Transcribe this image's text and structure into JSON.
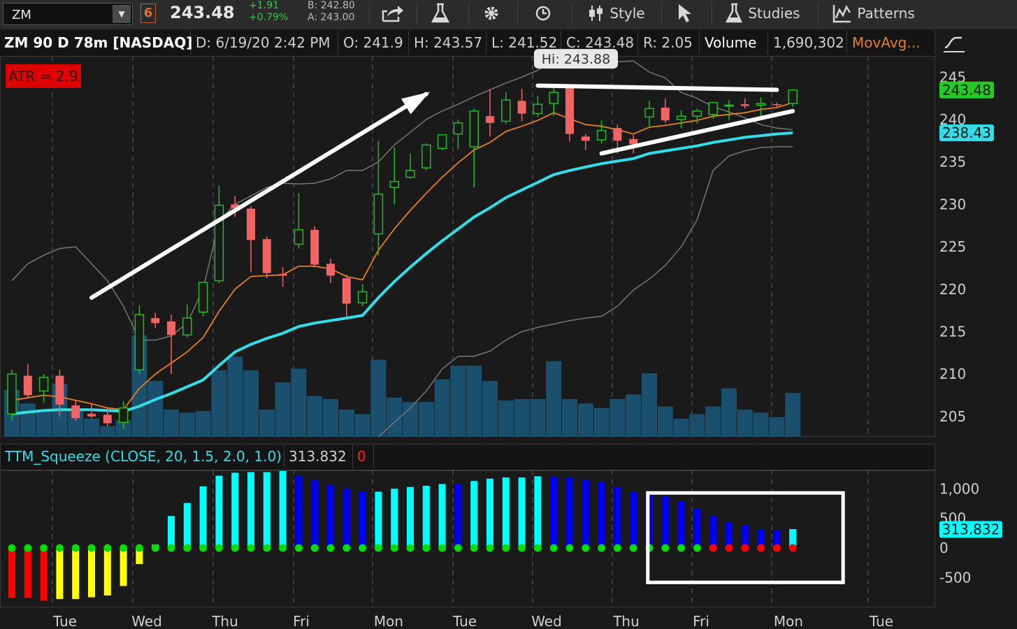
{
  "toolbar": {
    "symbol": "ZM",
    "badge": "6",
    "last": "243.48",
    "change": "+1.91",
    "change_pct": "+0.79%",
    "bid": "B: 242.80",
    "ask": "A: 243.00",
    "style_label": "Style",
    "studies_label": "Studies",
    "patterns_label": "Patterns"
  },
  "infobar": {
    "title": "ZM 90 D 78m [NASDAQ]",
    "date": "D: 6/19/20 2:42 PM",
    "open": "O: 241.9",
    "high": "H: 243.57",
    "low": "L: 241.52",
    "close": "C: 243.48",
    "range": "R: 2.05",
    "volume_label": "Volume",
    "volume_value": "1,690,302",
    "movavg": "MovAvg..."
  },
  "atr_label": "ATR = 2.9",
  "hi_label": "Hi: 243.88",
  "indicator_header": {
    "study": "TTM_Squeeze (CLOSE, 20, 1.5, 2.0, 1.0)",
    "value": "313.832",
    "value2": "0"
  },
  "colors": {
    "up": "#22bb22",
    "down": "#f06464",
    "volume": "#1b4f6e",
    "ema_fast": "#e67e22",
    "ema_slow": "#33dde8",
    "gray_line": "#777777",
    "squeeze_cyan": "#00ffff",
    "squeeze_blue": "#0000ee",
    "squeeze_yellow": "#ffff00",
    "squeeze_red": "#ff0000",
    "dot_green": "#00dd00",
    "dot_red": "#ff0000"
  },
  "chart_data": [
    {
      "type": "candlestick",
      "title": "ZM 90 D 78m [NASDAQ]",
      "ylim": [
        202.6,
        247.5
      ],
      "y_ticks": [
        205,
        210,
        215,
        220,
        225,
        230,
        235,
        240,
        245
      ],
      "x_day_labels": [
        "Tue",
        "Wed",
        "Thu",
        "Fri",
        "Mon",
        "Tue",
        "Wed",
        "Thu",
        "Fri",
        "Mon",
        "Tue"
      ],
      "price_tags": [
        {
          "label": "243.48",
          "value": 243.48,
          "color": "#22cc22"
        },
        {
          "label": "238.43",
          "value": 238.43,
          "color": "#33dde8"
        }
      ],
      "candles": [
        {
          "o": 205.3,
          "h": 210.5,
          "l": 204.5,
          "c": 210.0
        },
        {
          "o": 209.8,
          "h": 211.2,
          "l": 207.2,
          "c": 207.5
        },
        {
          "o": 208.0,
          "h": 210.0,
          "l": 206.6,
          "c": 209.6
        },
        {
          "o": 209.8,
          "h": 210.5,
          "l": 205.0,
          "c": 206.4
        },
        {
          "o": 206.3,
          "h": 206.9,
          "l": 204.5,
          "c": 204.8
        },
        {
          "o": 205.3,
          "h": 206.5,
          "l": 204.8,
          "c": 205.0
        },
        {
          "o": 205.2,
          "h": 205.9,
          "l": 203.8,
          "c": 204.2
        },
        {
          "o": 204.3,
          "h": 206.8,
          "l": 203.5,
          "c": 206.0
        },
        {
          "o": 210.5,
          "h": 218.1,
          "l": 210.0,
          "c": 217.0
        },
        {
          "o": 216.6,
          "h": 217.2,
          "l": 215.4,
          "c": 216.0
        },
        {
          "o": 216.2,
          "h": 217.0,
          "l": 210.0,
          "c": 214.6
        },
        {
          "o": 214.6,
          "h": 218.2,
          "l": 214.3,
          "c": 216.6
        },
        {
          "o": 217.3,
          "h": 220.6,
          "l": 216.8,
          "c": 220.8
        },
        {
          "o": 221.0,
          "h": 232.2,
          "l": 220.7,
          "c": 229.9
        },
        {
          "o": 230.0,
          "h": 231.0,
          "l": 228.5,
          "c": 229.5
        },
        {
          "o": 229.5,
          "h": 229.8,
          "l": 222.0,
          "c": 225.8
        },
        {
          "o": 225.9,
          "h": 226.2,
          "l": 221.3,
          "c": 221.9
        },
        {
          "o": 221.8,
          "h": 222.6,
          "l": 220.3,
          "c": 221.6
        },
        {
          "o": 225.3,
          "h": 231.3,
          "l": 224.8,
          "c": 227.0
        },
        {
          "o": 227.0,
          "h": 227.4,
          "l": 222.6,
          "c": 222.9
        },
        {
          "o": 223.0,
          "h": 223.6,
          "l": 220.7,
          "c": 221.6
        },
        {
          "o": 221.3,
          "h": 221.7,
          "l": 216.7,
          "c": 218.3
        },
        {
          "o": 218.4,
          "h": 220.6,
          "l": 218.0,
          "c": 219.7
        },
        {
          "o": 226.5,
          "h": 237.5,
          "l": 224.0,
          "c": 231.2
        },
        {
          "o": 232.0,
          "h": 236.7,
          "l": 230.0,
          "c": 232.7
        },
        {
          "o": 233.2,
          "h": 236.0,
          "l": 233.0,
          "c": 234.0
        },
        {
          "o": 234.3,
          "h": 237.2,
          "l": 234.0,
          "c": 237.0
        },
        {
          "o": 236.6,
          "h": 238.2,
          "l": 236.4,
          "c": 238.2
        },
        {
          "o": 238.3,
          "h": 240.0,
          "l": 236.5,
          "c": 239.6
        },
        {
          "o": 236.8,
          "h": 241.3,
          "l": 232.0,
          "c": 241.0
        },
        {
          "o": 240.4,
          "h": 243.6,
          "l": 238.0,
          "c": 239.6
        },
        {
          "o": 239.8,
          "h": 243.2,
          "l": 239.5,
          "c": 242.3
        },
        {
          "o": 242.2,
          "h": 243.6,
          "l": 239.8,
          "c": 240.7
        },
        {
          "o": 240.7,
          "h": 242.8,
          "l": 240.3,
          "c": 241.8
        },
        {
          "o": 241.9,
          "h": 243.7,
          "l": 240.4,
          "c": 243.2
        },
        {
          "o": 243.8,
          "h": 243.9,
          "l": 237.4,
          "c": 238.3
        },
        {
          "o": 238.0,
          "h": 238.3,
          "l": 236.4,
          "c": 237.5
        },
        {
          "o": 237.6,
          "h": 239.9,
          "l": 237.2,
          "c": 238.7
        },
        {
          "o": 239.0,
          "h": 239.4,
          "l": 236.0,
          "c": 237.5
        },
        {
          "o": 237.7,
          "h": 238.2,
          "l": 236.0,
          "c": 237.1
        },
        {
          "o": 240.3,
          "h": 242.2,
          "l": 239.2,
          "c": 241.3
        },
        {
          "o": 241.4,
          "h": 242.5,
          "l": 239.6,
          "c": 239.9
        },
        {
          "o": 240.0,
          "h": 241.1,
          "l": 239.0,
          "c": 240.4
        },
        {
          "o": 240.4,
          "h": 241.3,
          "l": 239.5,
          "c": 241.0
        },
        {
          "o": 240.6,
          "h": 242.1,
          "l": 240.1,
          "c": 242.0
        },
        {
          "o": 241.6,
          "h": 242.3,
          "l": 239.9,
          "c": 241.7
        },
        {
          "o": 241.8,
          "h": 242.5,
          "l": 241.3,
          "c": 241.6
        },
        {
          "o": 241.7,
          "h": 242.6,
          "l": 240.2,
          "c": 241.9
        },
        {
          "o": 241.8,
          "h": 242.0,
          "l": 241.5,
          "c": 241.7
        },
        {
          "o": 241.9,
          "h": 243.57,
          "l": 241.52,
          "c": 243.48
        }
      ],
      "ema_fast": [
        206.9,
        207.2,
        207.5,
        207.3,
        206.9,
        206.5,
        206.0,
        205.8,
        208.3,
        210.0,
        211.3,
        212.6,
        214.3,
        217.4,
        220.0,
        221.5,
        221.6,
        221.7,
        222.7,
        222.7,
        222.4,
        221.5,
        221.1,
        224.6,
        227.1,
        229.3,
        231.3,
        233.2,
        234.9,
        236.4,
        237.3,
        238.6,
        239.2,
        239.9,
        240.8,
        240.1,
        239.4,
        239.2,
        238.8,
        238.3,
        239.1,
        239.3,
        239.6,
        239.9,
        240.4,
        240.6,
        240.8,
        241.2,
        241.4,
        242.0
      ],
      "ema_slow": [
        205.3,
        205.5,
        205.7,
        205.8,
        205.8,
        205.8,
        205.7,
        205.6,
        206.2,
        207.0,
        207.7,
        208.5,
        209.3,
        211.0,
        212.6,
        213.5,
        214.2,
        214.8,
        215.6,
        216.0,
        216.3,
        216.6,
        216.9,
        219.0,
        220.9,
        222.6,
        224.2,
        225.7,
        227.1,
        228.5,
        229.6,
        230.8,
        231.7,
        232.6,
        233.5,
        234.0,
        234.4,
        234.8,
        235.1,
        235.4,
        236.0,
        236.3,
        236.6,
        236.9,
        237.3,
        237.6,
        237.9,
        238.1,
        238.3,
        238.43
      ],
      "gray_line": [
        221.0,
        223.0,
        224.0,
        224.8,
        225.0,
        223.0,
        221.0,
        218.0,
        214.0,
        214.0,
        214.5,
        216.0,
        220.0,
        228.0,
        230.0,
        231.0,
        232.0,
        232.5,
        232.4,
        232.5,
        233.0,
        234.0,
        234.0,
        235.0,
        237.0,
        238.5,
        240.0,
        241.0,
        241.8,
        242.7,
        243.5,
        244.3,
        245.0,
        245.8,
        246.9,
        247.1,
        246.9,
        246.8,
        246.8,
        246.9,
        245.6,
        244.9,
        243.2,
        242.5,
        241.5,
        240.9,
        240.2,
        239.4,
        239.0,
        238.8
      ],
      "gray_line2": [
        null,
        null,
        null,
        null,
        null,
        null,
        null,
        null,
        null,
        null,
        null,
        null,
        null,
        null,
        null,
        null,
        null,
        null,
        null,
        null,
        null,
        null,
        null,
        202.6,
        204.3,
        206.0,
        208.0,
        210.6,
        212.1,
        212.1,
        212.7,
        214.0,
        215.0,
        215.5,
        215.9,
        216.3,
        216.6,
        216.8,
        218.0,
        219.9,
        221.2,
        222.8,
        225.0,
        228.2,
        234.0,
        235.7,
        236.3,
        236.7,
        236.8,
        236.8
      ],
      "volume_ratio": [
        0.31,
        0.22,
        0.18,
        0.35,
        0.17,
        0.12,
        0.07,
        0.11,
        0.67,
        0.37,
        0.18,
        0.16,
        0.17,
        0.44,
        0.53,
        0.44,
        0.18,
        0.36,
        0.45,
        0.27,
        0.25,
        0.18,
        0.15,
        0.51,
        0.26,
        0.23,
        0.23,
        0.38,
        0.47,
        0.47,
        0.37,
        0.24,
        0.25,
        0.25,
        0.5,
        0.25,
        0.22,
        0.19,
        0.25,
        0.28,
        0.42,
        0.2,
        0.12,
        0.15,
        0.2,
        0.32,
        0.18,
        0.16,
        0.13,
        0.29
      ],
      "trendlines": [
        {
          "from": [
            5,
            219.0
          ],
          "to": [
            26,
            243.0
          ],
          "arrow": true
        },
        {
          "from": [
            33,
            244.0
          ],
          "to": [
            48,
            243.5
          ],
          "arrow": false
        },
        {
          "from": [
            37,
            236.0
          ],
          "to": [
            49,
            241.0
          ],
          "arrow": false
        }
      ]
    },
    {
      "type": "bar",
      "title": "TTM_Squeeze (CLOSE, 20, 1.5, 2.0, 1.0)",
      "ylim": [
        -1000,
        1310
      ],
      "y_ticks": [
        1000,
        500,
        0,
        -500
      ],
      "value_tag": "313.832",
      "values": [
        -840,
        -840,
        -890,
        -860,
        -860,
        -830,
        -800,
        -640,
        -270,
        60,
        540,
        760,
        1040,
        1220,
        1270,
        1280,
        1280,
        1300,
        1220,
        1150,
        1060,
        1000,
        950,
        950,
        1000,
        1030,
        1050,
        1080,
        1080,
        1130,
        1170,
        1190,
        1190,
        1210,
        1200,
        1190,
        1150,
        1120,
        1030,
        940,
        900,
        870,
        780,
        660,
        540,
        440,
        380,
        320,
        300,
        320
      ],
      "bar_colors": [
        "red",
        "red",
        "red",
        "yellow",
        "yellow",
        "yellow",
        "yellow",
        "yellow",
        "yellow",
        "cyan",
        "cyan",
        "cyan",
        "cyan",
        "cyan",
        "cyan",
        "cyan",
        "cyan",
        "cyan",
        "blue",
        "blue",
        "blue",
        "blue",
        "blue",
        "cyan",
        "cyan",
        "cyan",
        "cyan",
        "cyan",
        "blue",
        "cyan",
        "cyan",
        "cyan",
        "cyan",
        "cyan",
        "blue",
        "blue",
        "blue",
        "blue",
        "blue",
        "blue",
        "blue",
        "blue",
        "blue",
        "blue",
        "blue",
        "blue",
        "blue",
        "blue",
        "blue",
        "cyan"
      ],
      "dot_colors": [
        "green",
        "green",
        "green",
        "green",
        "green",
        "green",
        "green",
        "green",
        "green",
        "green",
        "green",
        "green",
        "green",
        "green",
        "green",
        "green",
        "green",
        "green",
        "green",
        "green",
        "green",
        "green",
        "green",
        "green",
        "green",
        "green",
        "green",
        "green",
        "green",
        "green",
        "green",
        "green",
        "green",
        "green",
        "green",
        "green",
        "green",
        "green",
        "green",
        "green",
        "green",
        "green",
        "green",
        "green",
        "red",
        "red",
        "red",
        "red",
        "red",
        "red"
      ],
      "highlight_box": {
        "from": 41,
        "to": 49
      }
    }
  ]
}
